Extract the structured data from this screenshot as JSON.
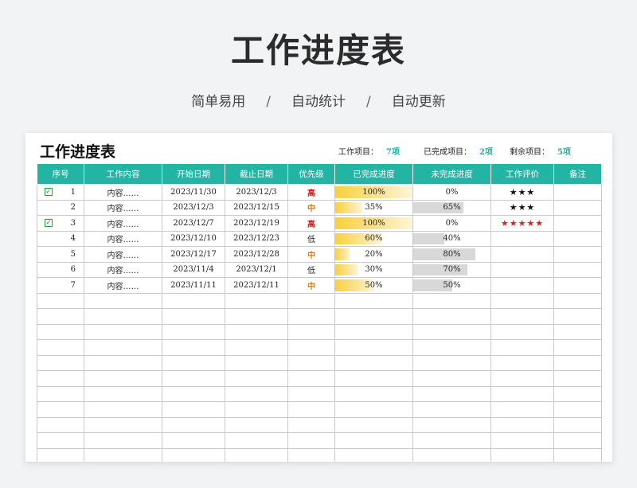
{
  "hero": {
    "title": "工作进度表",
    "subtitle": [
      "简单易用",
      "自动统计",
      "自动更新"
    ],
    "separator": "/"
  },
  "sheet": {
    "title": "工作进度表",
    "stats": [
      {
        "label": "工作项目：",
        "value": "7项"
      },
      {
        "label": "已完成项目：",
        "value": "2项"
      },
      {
        "label": "剩余项目：",
        "value": "5项"
      }
    ],
    "columns": [
      "序号",
      "工作内容",
      "开始日期",
      "截止日期",
      "优先级",
      "已完成进度",
      "未完成进度",
      "工作评价",
      "备注"
    ],
    "rows": [
      {
        "checked": true,
        "idx": "1",
        "content": "内容……",
        "start": "2023/11/30",
        "end": "2023/12/3",
        "priority": "高",
        "done": "100%",
        "done_pct": 100,
        "remain": "0%",
        "remain_pct": 0,
        "rating": "★★★",
        "rating_color": "black",
        "note": ""
      },
      {
        "checked": false,
        "idx": "2",
        "content": "内容……",
        "start": "2023/12/3",
        "end": "2023/12/15",
        "priority": "中",
        "done": "35%",
        "done_pct": 35,
        "remain": "65%",
        "remain_pct": 65,
        "rating": "★★★",
        "rating_color": "black",
        "note": ""
      },
      {
        "checked": true,
        "idx": "3",
        "content": "内容……",
        "start": "2023/12/7",
        "end": "2023/12/19",
        "priority": "高",
        "done": "100%",
        "done_pct": 100,
        "remain": "0%",
        "remain_pct": 0,
        "rating": "★★★★★",
        "rating_color": "red",
        "note": ""
      },
      {
        "checked": false,
        "idx": "4",
        "content": "内容……",
        "start": "2023/12/10",
        "end": "2023/12/23",
        "priority": "低",
        "done": "60%",
        "done_pct": 60,
        "remain": "40%",
        "remain_pct": 40,
        "rating": "",
        "rating_color": "black",
        "note": ""
      },
      {
        "checked": false,
        "idx": "5",
        "content": "内容……",
        "start": "2023/12/17",
        "end": "2023/12/28",
        "priority": "中",
        "done": "20%",
        "done_pct": 20,
        "remain": "80%",
        "remain_pct": 80,
        "rating": "",
        "rating_color": "black",
        "note": ""
      },
      {
        "checked": false,
        "idx": "6",
        "content": "内容……",
        "start": "2023/11/4",
        "end": "2023/12/1",
        "priority": "低",
        "done": "30%",
        "done_pct": 30,
        "remain": "70%",
        "remain_pct": 70,
        "rating": "",
        "rating_color": "black",
        "note": ""
      },
      {
        "checked": false,
        "idx": "7",
        "content": "内容……",
        "start": "2023/11/11",
        "end": "2023/12/11",
        "priority": "中",
        "done": "50%",
        "done_pct": 50,
        "remain": "50%",
        "remain_pct": 50,
        "rating": "",
        "rating_color": "black",
        "note": ""
      }
    ],
    "empty_rows": 11,
    "colors": {
      "header_bg": "#22b5a3",
      "accent": "#19b3a0",
      "priority_high": "#d21919",
      "priority_mid": "#e07a12",
      "bar_done": "#f8d13c",
      "bar_remain": "#d8d8d8",
      "rating_red": "#e02020"
    },
    "icons": {
      "check": "checkbox-checked-icon"
    }
  }
}
